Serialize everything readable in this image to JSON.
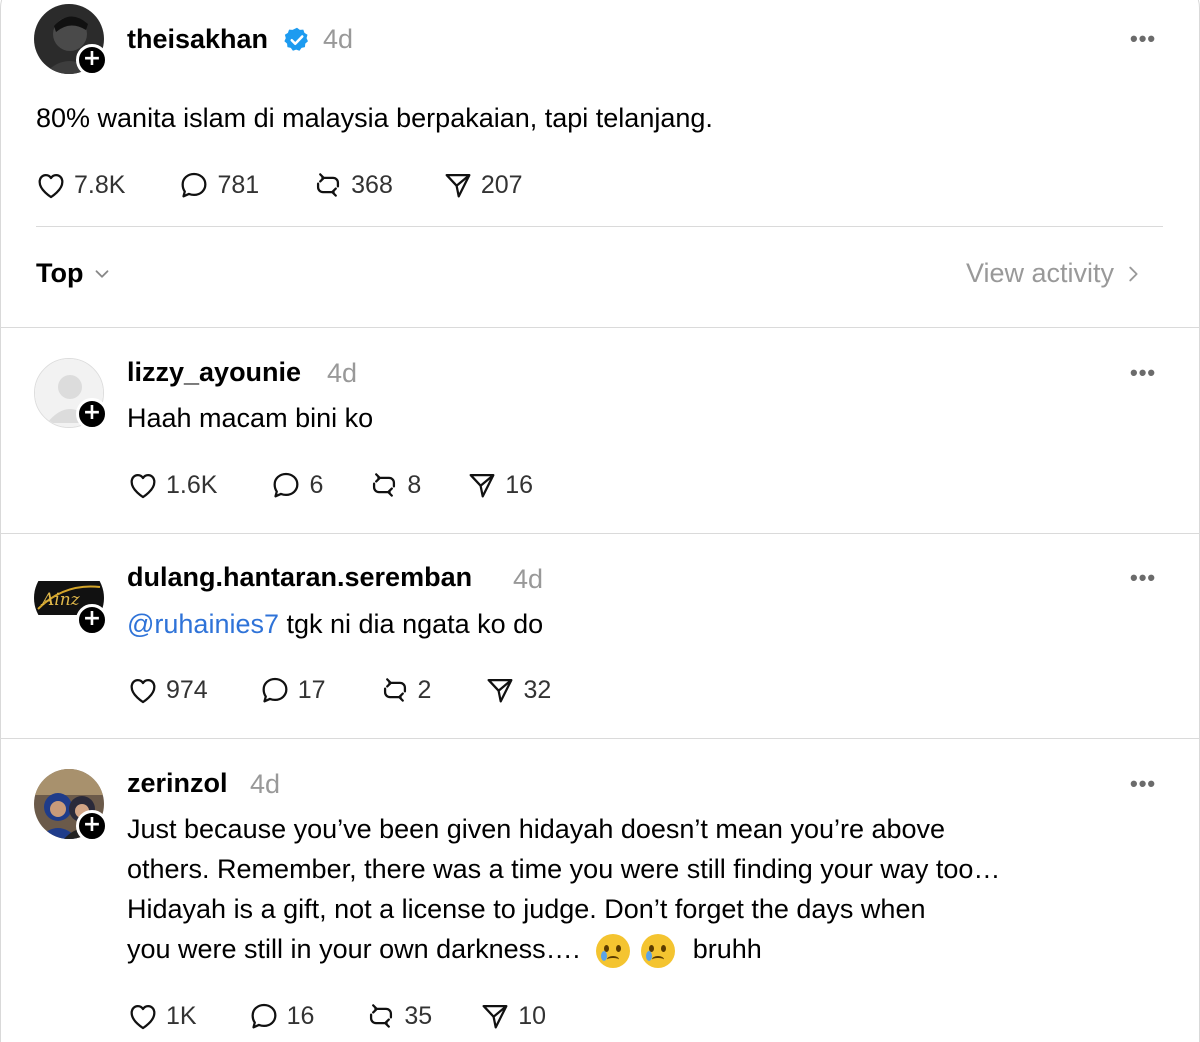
{
  "post": {
    "username": "theisakhan",
    "time": "4d",
    "text": "80% wanita islam di malaysia berpakaian, tapi telanjang.",
    "likes": "7.8K",
    "replies": "781",
    "reposts": "368",
    "shares": "207"
  },
  "sort": {
    "label": "Top",
    "view_activity": "View activity"
  },
  "comments": [
    {
      "username": "lizzy_ayounie",
      "time": "4d",
      "text": "Haah macam bini ko",
      "likes": "1.6K",
      "replies": "6",
      "reposts": "8",
      "shares": "16"
    },
    {
      "username": "dulang.hantaran.seremban",
      "time": "4d",
      "mention": "@ruhainies7",
      "text": " tgk ni dia ngata ko do",
      "avatar_text": "Ainz",
      "likes": "974",
      "replies": "17",
      "reposts": "2",
      "shares": "32"
    },
    {
      "username": "zerinzol",
      "time": "4d",
      "lines": [
        "Just because you’ve been given hidayah doesn’t mean you’re above",
        "others. Remember, there was a time you were still finding your way too…",
        "Hidayah is a gift, not a license to judge. Don’t forget the days when",
        "you were still in your own darkness…."
      ],
      "tail": "bruhh",
      "likes": "1K",
      "replies": "16",
      "reposts": "35",
      "shares": "10"
    }
  ],
  "icons": {
    "like": "heart-icon",
    "reply": "speech-bubble-icon",
    "repost": "repost-icon",
    "share": "paper-plane-icon",
    "more": "more-options-icon",
    "verified": "verified-badge-icon",
    "follow": "plus-icon",
    "emoji": "crying-face-emoji"
  },
  "colors": {
    "verified": "#1d9bf0",
    "mention": "#2f73d8",
    "muted": "#999999",
    "divider": "#dadada"
  }
}
